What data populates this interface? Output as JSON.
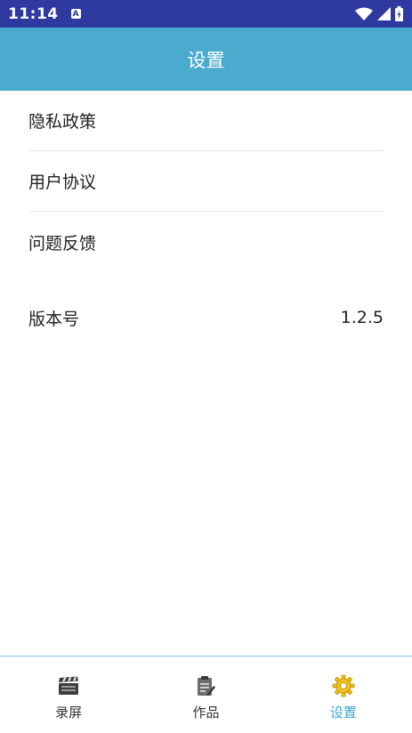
{
  "status_bar": {
    "time": "11:14",
    "notification_icon": "a-icon",
    "icons": [
      "wifi-icon",
      "signal-icon",
      "battery-icon"
    ]
  },
  "header": {
    "title": "设置"
  },
  "menu": {
    "items": [
      {
        "label": "隐私政策"
      },
      {
        "label": "用户协议"
      },
      {
        "label": "问题反馈"
      }
    ]
  },
  "version": {
    "label": "版本号",
    "value": "1.2.5"
  },
  "tab_bar": {
    "tabs": [
      {
        "label": "录屏",
        "icon": "clapperboard-icon",
        "active": false
      },
      {
        "label": "作品",
        "icon": "clipboard-edit-icon",
        "active": false
      },
      {
        "label": "设置",
        "icon": "gear-icon",
        "active": true
      }
    ]
  },
  "colors": {
    "status_bar": "#2e3aa0",
    "header": "#4aabcf",
    "active_tab": "#3ea6cf",
    "active_icon": "#f2c21a"
  }
}
